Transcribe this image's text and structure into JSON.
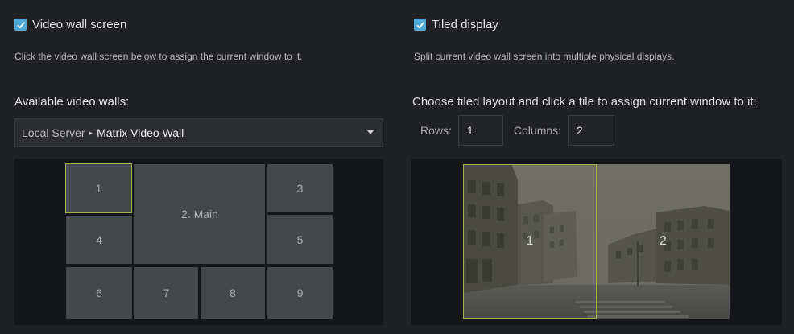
{
  "left": {
    "checkbox_label": "Video wall screen",
    "description": "Click the video wall screen below to assign the current window to it.",
    "available_label": "Available video walls:",
    "dropdown": {
      "server": "Local Server",
      "separator": "▸",
      "wall": "Matrix Video Wall"
    },
    "cells": [
      "1",
      "2. Main",
      "3",
      "4",
      "5",
      "6",
      "7",
      "8",
      "9"
    ]
  },
  "right": {
    "checkbox_label": "Tiled display",
    "description": "Split current video wall screen into multiple physical displays.",
    "choose_label": "Choose tiled layout and click a tile to assign current window to it:",
    "rows_label": "Rows:",
    "rows_value": "1",
    "columns_label": "Columns:",
    "columns_value": "2",
    "tiles": [
      "1",
      "2"
    ]
  },
  "colors": {
    "checkbox": "#4fa9d6",
    "selected_border": "#a9b54a",
    "background": "#1f2124"
  }
}
